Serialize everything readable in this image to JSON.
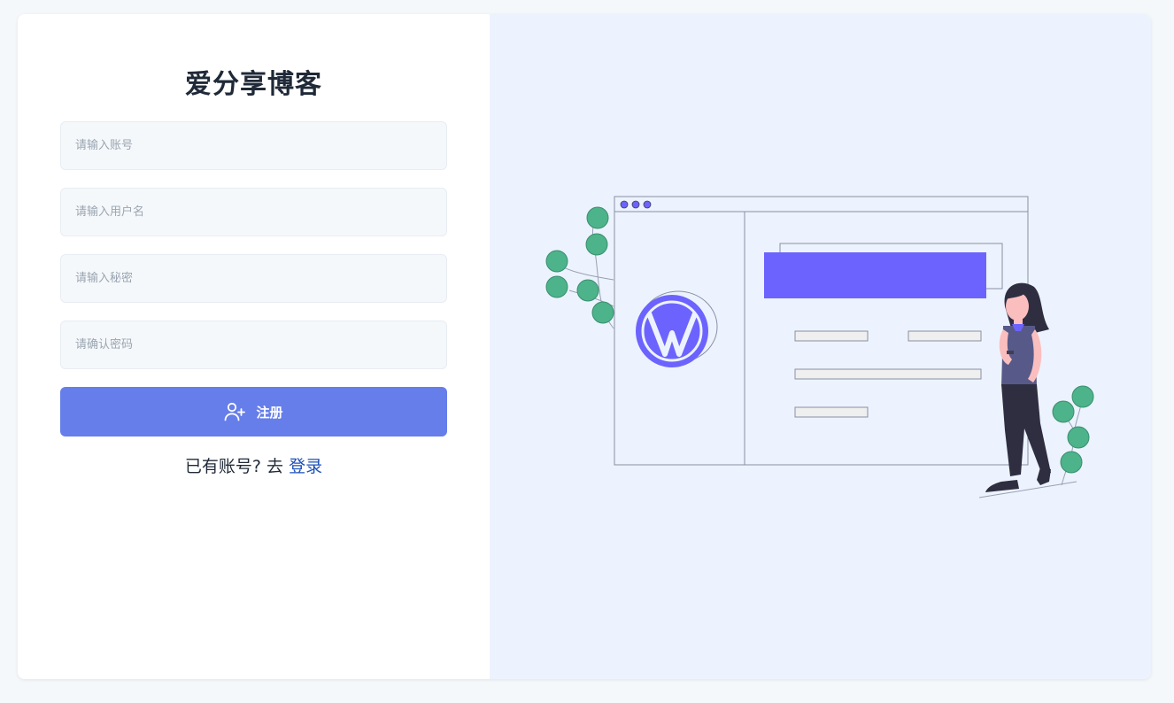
{
  "form": {
    "title": "爱分享博客",
    "account_placeholder": "请输入账号",
    "username_placeholder": "请输入用户名",
    "password_placeholder": "请输入秘密",
    "confirm_placeholder": "请确认密码",
    "submit_label": "注册",
    "submit_icon": "user-plus-icon",
    "have_account_text": "已有账号? 去",
    "login_link_label": "登录"
  },
  "colors": {
    "primary_button": "#667eea",
    "link": "#1d4fb8",
    "illustration_accent": "#6c63ff",
    "panel_background": "#ecf3fe"
  }
}
